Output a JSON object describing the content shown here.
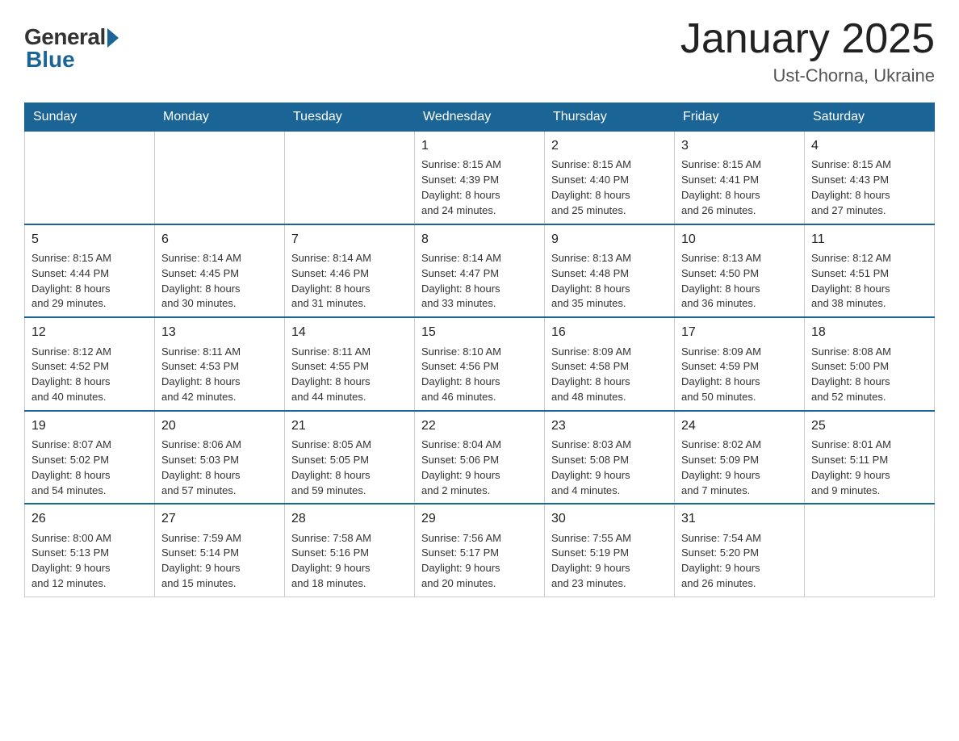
{
  "header": {
    "logo_general": "General",
    "logo_blue": "Blue",
    "month_title": "January 2025",
    "location": "Ust-Chorna, Ukraine"
  },
  "weekdays": [
    "Sunday",
    "Monday",
    "Tuesday",
    "Wednesday",
    "Thursday",
    "Friday",
    "Saturday"
  ],
  "weeks": [
    [
      {
        "day": "",
        "info": ""
      },
      {
        "day": "",
        "info": ""
      },
      {
        "day": "",
        "info": ""
      },
      {
        "day": "1",
        "info": "Sunrise: 8:15 AM\nSunset: 4:39 PM\nDaylight: 8 hours\nand 24 minutes."
      },
      {
        "day": "2",
        "info": "Sunrise: 8:15 AM\nSunset: 4:40 PM\nDaylight: 8 hours\nand 25 minutes."
      },
      {
        "day": "3",
        "info": "Sunrise: 8:15 AM\nSunset: 4:41 PM\nDaylight: 8 hours\nand 26 minutes."
      },
      {
        "day": "4",
        "info": "Sunrise: 8:15 AM\nSunset: 4:43 PM\nDaylight: 8 hours\nand 27 minutes."
      }
    ],
    [
      {
        "day": "5",
        "info": "Sunrise: 8:15 AM\nSunset: 4:44 PM\nDaylight: 8 hours\nand 29 minutes."
      },
      {
        "day": "6",
        "info": "Sunrise: 8:14 AM\nSunset: 4:45 PM\nDaylight: 8 hours\nand 30 minutes."
      },
      {
        "day": "7",
        "info": "Sunrise: 8:14 AM\nSunset: 4:46 PM\nDaylight: 8 hours\nand 31 minutes."
      },
      {
        "day": "8",
        "info": "Sunrise: 8:14 AM\nSunset: 4:47 PM\nDaylight: 8 hours\nand 33 minutes."
      },
      {
        "day": "9",
        "info": "Sunrise: 8:13 AM\nSunset: 4:48 PM\nDaylight: 8 hours\nand 35 minutes."
      },
      {
        "day": "10",
        "info": "Sunrise: 8:13 AM\nSunset: 4:50 PM\nDaylight: 8 hours\nand 36 minutes."
      },
      {
        "day": "11",
        "info": "Sunrise: 8:12 AM\nSunset: 4:51 PM\nDaylight: 8 hours\nand 38 minutes."
      }
    ],
    [
      {
        "day": "12",
        "info": "Sunrise: 8:12 AM\nSunset: 4:52 PM\nDaylight: 8 hours\nand 40 minutes."
      },
      {
        "day": "13",
        "info": "Sunrise: 8:11 AM\nSunset: 4:53 PM\nDaylight: 8 hours\nand 42 minutes."
      },
      {
        "day": "14",
        "info": "Sunrise: 8:11 AM\nSunset: 4:55 PM\nDaylight: 8 hours\nand 44 minutes."
      },
      {
        "day": "15",
        "info": "Sunrise: 8:10 AM\nSunset: 4:56 PM\nDaylight: 8 hours\nand 46 minutes."
      },
      {
        "day": "16",
        "info": "Sunrise: 8:09 AM\nSunset: 4:58 PM\nDaylight: 8 hours\nand 48 minutes."
      },
      {
        "day": "17",
        "info": "Sunrise: 8:09 AM\nSunset: 4:59 PM\nDaylight: 8 hours\nand 50 minutes."
      },
      {
        "day": "18",
        "info": "Sunrise: 8:08 AM\nSunset: 5:00 PM\nDaylight: 8 hours\nand 52 minutes."
      }
    ],
    [
      {
        "day": "19",
        "info": "Sunrise: 8:07 AM\nSunset: 5:02 PM\nDaylight: 8 hours\nand 54 minutes."
      },
      {
        "day": "20",
        "info": "Sunrise: 8:06 AM\nSunset: 5:03 PM\nDaylight: 8 hours\nand 57 minutes."
      },
      {
        "day": "21",
        "info": "Sunrise: 8:05 AM\nSunset: 5:05 PM\nDaylight: 8 hours\nand 59 minutes."
      },
      {
        "day": "22",
        "info": "Sunrise: 8:04 AM\nSunset: 5:06 PM\nDaylight: 9 hours\nand 2 minutes."
      },
      {
        "day": "23",
        "info": "Sunrise: 8:03 AM\nSunset: 5:08 PM\nDaylight: 9 hours\nand 4 minutes."
      },
      {
        "day": "24",
        "info": "Sunrise: 8:02 AM\nSunset: 5:09 PM\nDaylight: 9 hours\nand 7 minutes."
      },
      {
        "day": "25",
        "info": "Sunrise: 8:01 AM\nSunset: 5:11 PM\nDaylight: 9 hours\nand 9 minutes."
      }
    ],
    [
      {
        "day": "26",
        "info": "Sunrise: 8:00 AM\nSunset: 5:13 PM\nDaylight: 9 hours\nand 12 minutes."
      },
      {
        "day": "27",
        "info": "Sunrise: 7:59 AM\nSunset: 5:14 PM\nDaylight: 9 hours\nand 15 minutes."
      },
      {
        "day": "28",
        "info": "Sunrise: 7:58 AM\nSunset: 5:16 PM\nDaylight: 9 hours\nand 18 minutes."
      },
      {
        "day": "29",
        "info": "Sunrise: 7:56 AM\nSunset: 5:17 PM\nDaylight: 9 hours\nand 20 minutes."
      },
      {
        "day": "30",
        "info": "Sunrise: 7:55 AM\nSunset: 5:19 PM\nDaylight: 9 hours\nand 23 minutes."
      },
      {
        "day": "31",
        "info": "Sunrise: 7:54 AM\nSunset: 5:20 PM\nDaylight: 9 hours\nand 26 minutes."
      },
      {
        "day": "",
        "info": ""
      }
    ]
  ]
}
